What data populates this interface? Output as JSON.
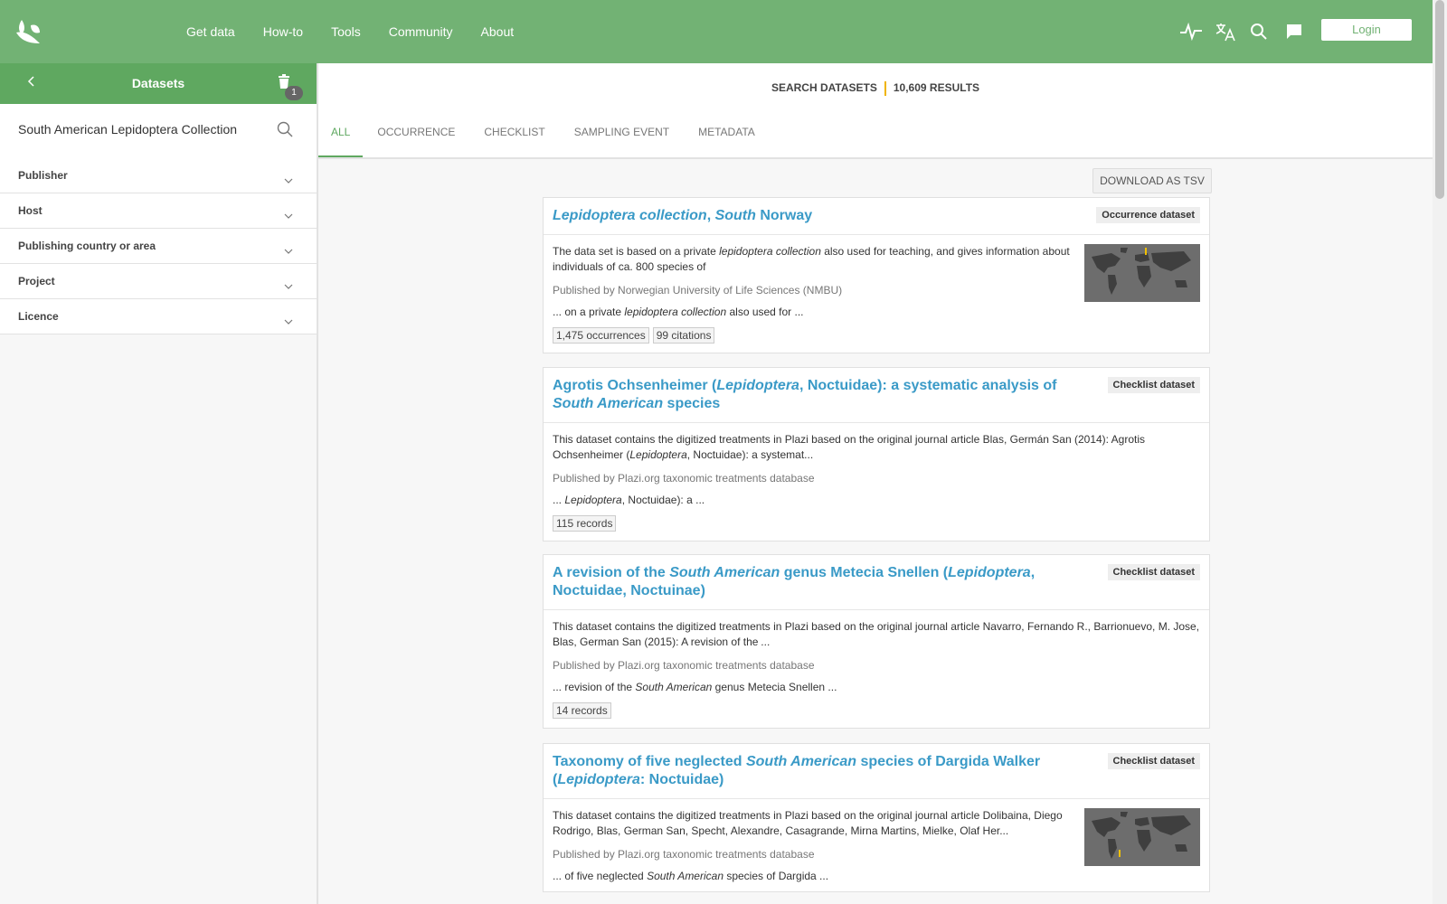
{
  "topbar": {
    "nav": [
      "Get data",
      "How-to",
      "Tools",
      "Community",
      "About"
    ],
    "login_label": "Login"
  },
  "sidebar": {
    "title": "Datasets",
    "filter_count": "1",
    "search_value": "South American Lepidoptera Collection",
    "facets": [
      "Publisher",
      "Host",
      "Publishing country or area",
      "Project",
      "Licence"
    ]
  },
  "search": {
    "label": "SEARCH DATASETS",
    "results": "10,609 RESULTS",
    "tabs": [
      "ALL",
      "OCCURRENCE",
      "CHECKLIST",
      "SAMPLING EVENT",
      "METADATA"
    ],
    "active_tab": "ALL",
    "download_label": "DOWNLOAD AS TSV"
  },
  "results": [
    {
      "title_parts": [
        {
          "t": "Lepidoptera collection",
          "em": true
        },
        {
          "t": ", "
        },
        {
          "t": "South",
          "em": true
        },
        {
          "t": " Norway"
        }
      ],
      "type": "Occurrence dataset",
      "desc_parts": [
        {
          "t": "The data set is based on a private "
        },
        {
          "t": "lepidoptera collection",
          "em": true
        },
        {
          "t": " also used for teaching, and gives information about individuals of ca. 800 species of"
        }
      ],
      "publisher": "Published by Norwegian University of Life Sciences (NMBU)",
      "snippet_parts": [
        {
          "t": "... on a private "
        },
        {
          "t": "lepidoptera collection",
          "em": true
        },
        {
          "t": " also used for ..."
        }
      ],
      "chips": [
        "1,475 occurrences",
        "99 citations"
      ],
      "has_map": true
    },
    {
      "title_parts": [
        {
          "t": "Agrotis Ochsenheimer ("
        },
        {
          "t": "Lepidoptera",
          "em": true
        },
        {
          "t": ", Noctuidae): a systematic analysis of "
        },
        {
          "t": "South American",
          "em": true
        },
        {
          "t": " species"
        }
      ],
      "type": "Checklist dataset",
      "desc_parts": [
        {
          "t": "This dataset contains the digitized treatments in Plazi based on the original journal article Blas, Germán San (2014): Agrotis Ochsenheimer ("
        },
        {
          "t": "Lepidoptera",
          "em": true
        },
        {
          "t": ", Noctuidae): a systemat..."
        }
      ],
      "publisher": "Published by Plazi.org taxonomic treatments database",
      "snippet_parts": [
        {
          "t": "... "
        },
        {
          "t": "Lepidoptera",
          "em": true
        },
        {
          "t": ", Noctuidae): a ..."
        }
      ],
      "chips": [
        "115 records"
      ],
      "has_map": false
    },
    {
      "title_parts": [
        {
          "t": "A revision of the "
        },
        {
          "t": "South American",
          "em": true
        },
        {
          "t": " genus Metecia Snellen ("
        },
        {
          "t": "Lepidoptera",
          "em": true
        },
        {
          "t": ", Noctuidae, Noctuinae)"
        }
      ],
      "type": "Checklist dataset",
      "desc_parts": [
        {
          "t": "This dataset contains the digitized treatments in Plazi based on the original journal article Navarro, Fernando R., Barrionuevo, M. Jose, Blas, German San (2015): A revision of the "
        },
        {
          "t": "...",
          "em": true
        }
      ],
      "publisher": "Published by Plazi.org taxonomic treatments database",
      "snippet_parts": [
        {
          "t": "... revision of the "
        },
        {
          "t": "South American",
          "em": true
        },
        {
          "t": " genus Metecia Snellen ..."
        }
      ],
      "chips": [
        "14 records"
      ],
      "has_map": false
    },
    {
      "title_parts": [
        {
          "t": "Taxonomy of five neglected "
        },
        {
          "t": "South American",
          "em": true
        },
        {
          "t": " species of Dargida Walker ("
        },
        {
          "t": "Lepidoptera",
          "em": true
        },
        {
          "t": ": Noctuidae)"
        }
      ],
      "type": "Checklist dataset",
      "desc_parts": [
        {
          "t": "This dataset contains the digitized treatments in Plazi based on the original journal article Dolibaina, Diego Rodrigo, Blas, German San, Specht, Alexandre, Casagrande, Mirna Martins, Mielke, Olaf Her..."
        }
      ],
      "publisher": "Published by Plazi.org taxonomic treatments database",
      "snippet_parts": [
        {
          "t": "... of five neglected "
        },
        {
          "t": "South American",
          "em": true
        },
        {
          "t": " species of Dargida ..."
        }
      ],
      "chips": [],
      "has_map": true
    }
  ],
  "colors": {
    "brand_green": "#72b274",
    "link_blue": "#3a9ac7",
    "accent_yellow": "#f0b400"
  }
}
